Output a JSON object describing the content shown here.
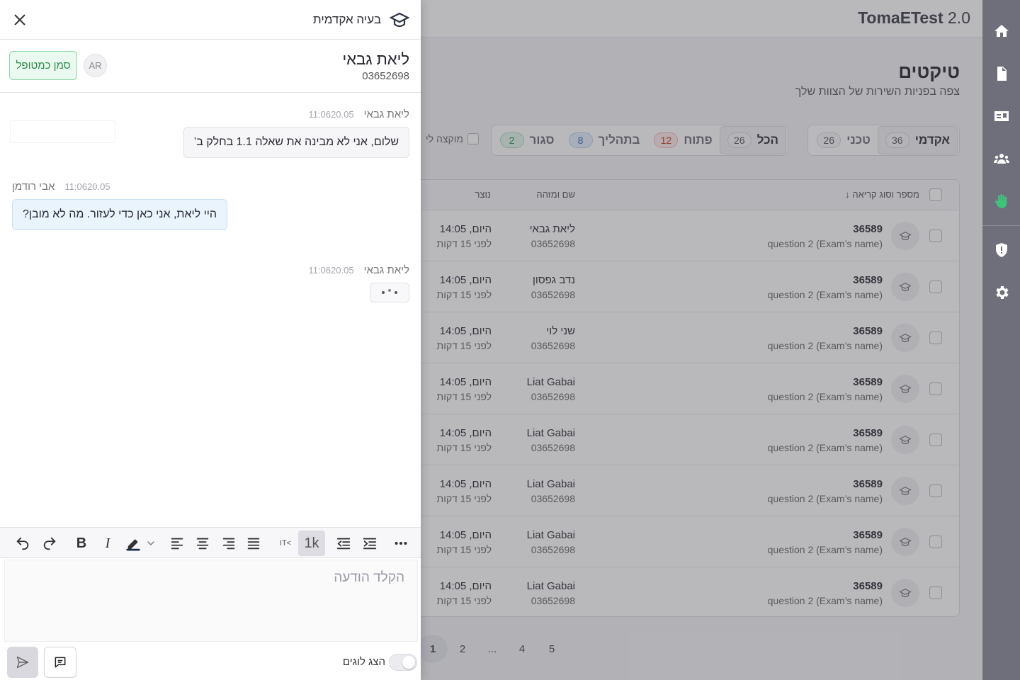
{
  "app": {
    "brand_bold": "TomaETest",
    "brand_version": "2.0"
  },
  "page": {
    "title": "טיקטים",
    "subtitle": "צפה בפניות השירות של הצוות שלך"
  },
  "type_tabs": [
    {
      "label": "אקדמי",
      "count": "36",
      "selected": true
    },
    {
      "label": "טכני",
      "count": "26",
      "selected": false
    }
  ],
  "status_tabs": [
    {
      "label": "הכל",
      "count": "26",
      "selected": true,
      "tone": "neutral"
    },
    {
      "label": "פתוח",
      "count": "12",
      "selected": false,
      "tone": "red"
    },
    {
      "label": "בתהליך",
      "count": "8",
      "selected": false,
      "tone": "blue"
    },
    {
      "label": "סגור",
      "count": "2",
      "selected": false,
      "tone": "green"
    }
  ],
  "assigned_filter": {
    "label": "מוקצה לי"
  },
  "table": {
    "headers": {
      "id": "מספר וסוג קריאה ↓",
      "name": "שם ומזהה",
      "created": "נוצר"
    },
    "rows": [
      {
        "id": "36589",
        "question": "question 2 (Exam’s name)",
        "name": "ליאת גבאי",
        "nid": "03652698",
        "time": "היום, 14:05",
        "ago": "לפני 15 דקות"
      },
      {
        "id": "36589",
        "question": "question 2 (Exam’s name)",
        "name": "נדב גפסון",
        "nid": "03652698",
        "time": "היום, 14:05",
        "ago": "לפני 15 דקות"
      },
      {
        "id": "36589",
        "question": "question 2 (Exam’s name)",
        "name": "שני לוי",
        "nid": "03652698",
        "time": "היום, 14:05",
        "ago": "לפני 15 דקות"
      },
      {
        "id": "36589",
        "question": "question 2 (Exam’s name)",
        "name": "Liat Gabai",
        "nid": "03652698",
        "time": "היום, 14:05",
        "ago": "לפני 15 דקות"
      },
      {
        "id": "36589",
        "question": "question 2 (Exam’s name)",
        "name": "Liat Gabai",
        "nid": "03652698",
        "time": "היום, 14:05",
        "ago": "לפני 15 דקות"
      },
      {
        "id": "36589",
        "question": "question 2 (Exam’s name)",
        "name": "Liat Gabai",
        "nid": "03652698",
        "time": "היום, 14:05",
        "ago": "לפני 15 דקות"
      },
      {
        "id": "36589",
        "question": "question 2 (Exam’s name)",
        "name": "Liat Gabai",
        "nid": "03652698",
        "time": "היום, 14:05",
        "ago": "לפני 15 דקות"
      },
      {
        "id": "36589",
        "question": "question 2 (Exam’s name)",
        "name": "Liat Gabai",
        "nid": "03652698",
        "time": "היום, 14:05",
        "ago": "לפני 15 דקות"
      }
    ]
  },
  "pagination": {
    "pages": [
      "1",
      "2",
      "...",
      "4",
      "5"
    ],
    "current": "1"
  },
  "panel": {
    "title": "בעיה אקדמית",
    "student_name": "ליאת גבאי",
    "student_id": "03652698",
    "avatar_initials": "AR",
    "mark_handled": "סמן כמטופל",
    "messages": [
      {
        "author": "ליאת גבאי",
        "time": "11:0620.05",
        "text": "שלום, אני לא מבינה את שאלה 1.1 בחלק ב’"
      },
      {
        "author": "אבי רודמן",
        "time": "11:0620.05",
        "text": "היי ליאת, אני כאן כדי לעזור. מה לא מובן?"
      },
      {
        "author": "ליאת גבאי",
        "time": "11:0620.05",
        "text": ""
      }
    ],
    "editor_placeholder": "הקלד הודעה",
    "show_logs_label": "הצג לוגים",
    "toolbar": {
      "font_size_label": "1k",
      "dir_label": "IT<"
    }
  },
  "colors": {
    "rail": "#6f6f7c",
    "accent_green": "#2b8a4a",
    "hand_icon": "#3fc37a"
  },
  "icons": {
    "rail": [
      "home-icon",
      "file-icon",
      "id-card-icon",
      "users-icon",
      "hand-icon",
      "shield-alert-icon",
      "gear-icon"
    ]
  }
}
